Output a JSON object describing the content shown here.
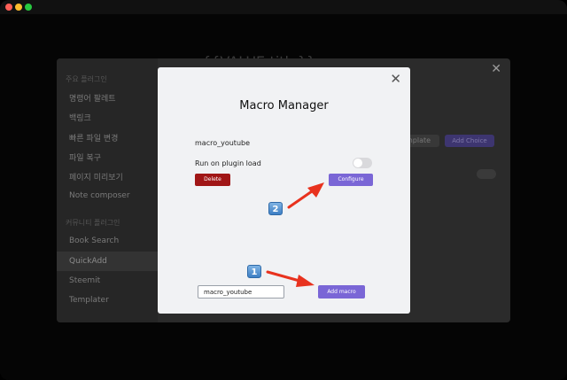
{
  "background": {
    "template_title": "{{VALUE:title}}"
  },
  "settings": {
    "sidebar": {
      "core_header": "주요 플러그인",
      "core_items": [
        "명령어 팔레트",
        "백링크",
        "빠른 파일 변경",
        "파일 복구",
        "페이지 미리보기",
        "Note composer"
      ],
      "community_header": "커뮤니티 플러그인",
      "community_items": [
        "Book Search",
        "QuickAdd",
        "Steemit",
        "Templater"
      ]
    },
    "select_value": "mplate",
    "add_choice_label": "Add Choice",
    "close_label": "✕"
  },
  "macro_manager": {
    "title": "Macro Manager",
    "macro_name": "macro_youtube",
    "run_on_load_label": "Run on plugin load",
    "run_on_load": false,
    "delete_label": "Delete",
    "configure_label": "Configure",
    "input_value": "macro_youtube",
    "add_macro_label": "Add macro",
    "close_label": "✕"
  },
  "annotations": {
    "badge_1": "1",
    "badge_2": "2",
    "arrow_color": "#e8321e"
  },
  "colors": {
    "accent": "#7a66d6",
    "danger": "#a01616"
  }
}
